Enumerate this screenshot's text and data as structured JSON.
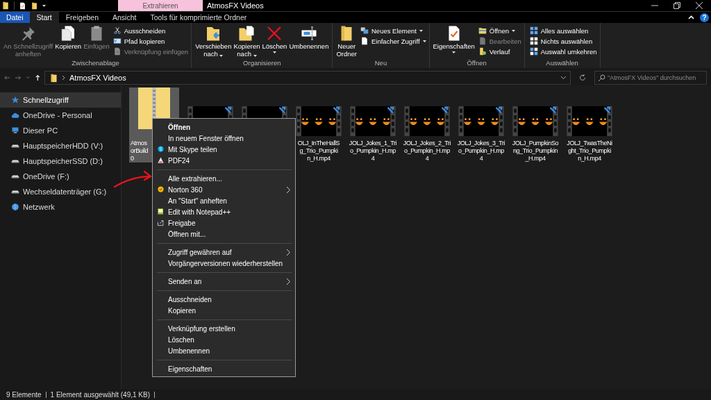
{
  "title_bar": {
    "context_tab": "Extrahieren",
    "title": "AtmosFX Videos"
  },
  "tabs": [
    {
      "label": "Datei",
      "kind": "file",
      "selected": false
    },
    {
      "label": "Start",
      "kind": "tab",
      "selected": true
    },
    {
      "label": "Freigeben",
      "kind": "tab",
      "selected": false
    },
    {
      "label": "Ansicht",
      "kind": "tab",
      "selected": false
    },
    {
      "label": "Tools für komprimierte Ordner",
      "kind": "tab",
      "selected": false
    }
  ],
  "help_label": "?",
  "ribbon": {
    "groups": [
      {
        "label": "Zwischenablage",
        "large": [
          {
            "label": "An Schnellzugriff\nanheften",
            "disabled": true,
            "dropdown": false
          },
          {
            "label": "Kopieren",
            "disabled": false,
            "dropdown": false
          },
          {
            "label": "Einfügen",
            "disabled": true,
            "dropdown": false
          }
        ],
        "small": [
          {
            "label": "Ausschneiden",
            "disabled": false,
            "dropdown": false
          },
          {
            "label": "Pfad kopieren",
            "disabled": false,
            "dropdown": false
          },
          {
            "label": "Verknüpfung einfügen",
            "disabled": true,
            "dropdown": false
          }
        ]
      },
      {
        "label": "Organisieren",
        "large": [
          {
            "label": "Verschieben\nnach",
            "disabled": false,
            "dropdown": true
          },
          {
            "label": "Kopieren\nnach",
            "disabled": false,
            "dropdown": true
          },
          {
            "label": "Löschen",
            "disabled": false,
            "dropdown": true
          },
          {
            "label": "Umbenennen",
            "disabled": false,
            "dropdown": false
          }
        ]
      },
      {
        "label": "Neu",
        "large": [
          {
            "label": "Neuer\nOrdner",
            "disabled": false,
            "dropdown": false
          }
        ],
        "small": [
          {
            "label": "Neues Element",
            "disabled": false,
            "dropdown": true
          },
          {
            "label": "Einfacher Zugriff",
            "disabled": false,
            "dropdown": true
          }
        ]
      },
      {
        "label": "Öffnen",
        "large": [
          {
            "label": "Eigenschaften",
            "disabled": false,
            "dropdown": true
          }
        ],
        "small": [
          {
            "label": "Öffnen",
            "disabled": false,
            "dropdown": true
          },
          {
            "label": "Bearbeiten",
            "disabled": true,
            "dropdown": false
          },
          {
            "label": "Verlauf",
            "disabled": false,
            "dropdown": false
          }
        ]
      },
      {
        "label": "Auswählen",
        "small": [
          {
            "label": "Alles auswählen",
            "disabled": false,
            "dropdown": false
          },
          {
            "label": "Nichts auswählen",
            "disabled": false,
            "dropdown": false
          },
          {
            "label": "Auswahl umkehren",
            "disabled": false,
            "dropdown": false
          }
        ]
      }
    ]
  },
  "address_bar": {
    "path": "AtmosFX Videos",
    "search_placeholder": "\"AtmosFX Videos\" durchsuchen"
  },
  "sidebar": {
    "items": [
      {
        "label": "Schnellzugriff",
        "selected": true
      },
      {
        "label": "OneDrive - Personal",
        "selected": false
      },
      {
        "label": "Dieser PC",
        "selected": false
      },
      {
        "label": "HauptspeicherHDD (V:)",
        "selected": false
      },
      {
        "label": "HauptspeicherSSD (D:)",
        "selected": false
      },
      {
        "label": "OneDrive (F:)",
        "selected": false
      },
      {
        "label": "Wechseldatenträger (G:)",
        "selected": false
      },
      {
        "label": "Netzwerk",
        "selected": false
      }
    ]
  },
  "files": [
    {
      "kind": "zip",
      "selected": true,
      "label_lines": [
        "Atmos",
        "orBuild",
        "0"
      ]
    },
    {
      "kind": "video",
      "selected": false
    },
    {
      "kind": "video",
      "selected": false
    },
    {
      "kind": "video",
      "selected": false,
      "label_lines": [
        "OLJ_InTheHallS",
        "g_Trio_Pumpki",
        "n_H.mp4"
      ]
    },
    {
      "kind": "video",
      "selected": false,
      "label_lines": [
        "JOLJ_Jokes_1_Tri",
        "o_Pumpkin_H.mp",
        "4"
      ]
    },
    {
      "kind": "video",
      "selected": false,
      "label_lines": [
        "JOLJ_Jokes_2_Tri",
        "o_Pumpkin_H.mp",
        "4"
      ]
    },
    {
      "kind": "video",
      "selected": false,
      "label_lines": [
        "JOLJ_Jokes_3_Tri",
        "o_Pumpkin_H.mp",
        "4"
      ]
    },
    {
      "kind": "video",
      "selected": false,
      "label_lines": [
        "JOLJ_PumpkinSo",
        "ng_Trio_Pumpkin",
        "_H.mp4"
      ]
    },
    {
      "kind": "video",
      "selected": false,
      "label_lines": [
        "JOLJ_TwasTheNi",
        "ght_Trio_Pumpki",
        "n_H.mp4"
      ]
    }
  ],
  "context_menu": {
    "items": [
      {
        "kind": "item",
        "label": "Öffnen",
        "bold": true,
        "submenu": false
      },
      {
        "kind": "item",
        "label": "In neuem Fenster öffnen",
        "bold": false,
        "submenu": false
      },
      {
        "kind": "item",
        "label": "Mit Skype teilen",
        "bold": false,
        "submenu": false
      },
      {
        "kind": "item",
        "label": "PDF24",
        "bold": false,
        "submenu": false
      },
      {
        "kind": "separator"
      },
      {
        "kind": "item",
        "label": "Alle extrahieren...",
        "bold": false,
        "submenu": false
      },
      {
        "kind": "item",
        "label": "Norton 360",
        "bold": false,
        "submenu": true
      },
      {
        "kind": "item",
        "label": "An \"Start\" anheften",
        "bold": false,
        "submenu": false
      },
      {
        "kind": "item",
        "label": "Edit with Notepad++",
        "bold": false,
        "submenu": false
      },
      {
        "kind": "item",
        "label": "Freigabe",
        "bold": false,
        "submenu": false
      },
      {
        "kind": "item",
        "label": "Öffnen mit...",
        "bold": false,
        "submenu": false
      },
      {
        "kind": "separator"
      },
      {
        "kind": "item",
        "label": "Zugriff gewähren auf",
        "bold": false,
        "submenu": true
      },
      {
        "kind": "item",
        "label": "Vorgängerversionen wiederherstellen",
        "bold": false,
        "submenu": false
      },
      {
        "kind": "separator"
      },
      {
        "kind": "item",
        "label": "Senden an",
        "bold": false,
        "submenu": true
      },
      {
        "kind": "separator"
      },
      {
        "kind": "item",
        "label": "Ausschneiden",
        "bold": false,
        "submenu": false
      },
      {
        "kind": "item",
        "label": "Kopieren",
        "bold": false,
        "submenu": false
      },
      {
        "kind": "separator"
      },
      {
        "kind": "item",
        "label": "Verknüpfung erstellen",
        "bold": false,
        "submenu": false
      },
      {
        "kind": "item",
        "label": "Löschen",
        "bold": false,
        "submenu": false
      },
      {
        "kind": "item",
        "label": "Umbenennen",
        "bold": false,
        "submenu": false
      },
      {
        "kind": "separator"
      },
      {
        "kind": "item",
        "label": "Eigenschaften",
        "bold": false,
        "submenu": false
      }
    ]
  },
  "status_bar": {
    "item_count": "9 Elemente",
    "selection": "1 Element ausgewählt (49,1 KB)"
  }
}
